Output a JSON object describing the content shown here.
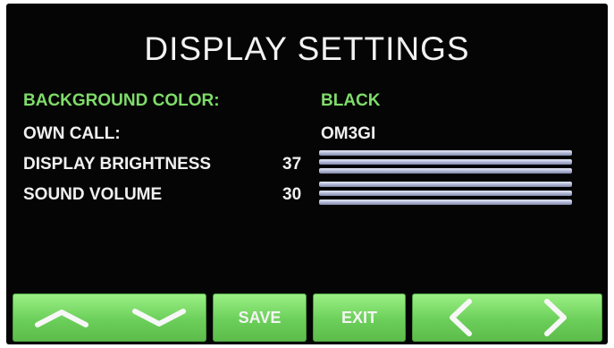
{
  "screen": {
    "title": "DISPLAY SETTINGS"
  },
  "settings": {
    "background_color": {
      "label": "BACKGROUND COLOR:",
      "value": "BLACK"
    },
    "own_call": {
      "label": "OWN CALL:",
      "value": "OM3GI"
    },
    "display_brightness": {
      "label": "DISPLAY BRIGHTNESS",
      "value": "37"
    },
    "sound_volume": {
      "label": "SOUND VOLUME",
      "value": "30"
    }
  },
  "buttons": {
    "save_label": "SAVE",
    "exit_label": "EXIT"
  },
  "icons": {
    "up": "chevron-up-icon",
    "down": "chevron-down-icon",
    "left": "chevron-left-icon",
    "right": "chevron-right-icon"
  },
  "colors": {
    "accent_green": "#7fdc6a",
    "button_green": "#6ccf5a",
    "screen_background": "#050505",
    "text": "#f0f0f0"
  }
}
